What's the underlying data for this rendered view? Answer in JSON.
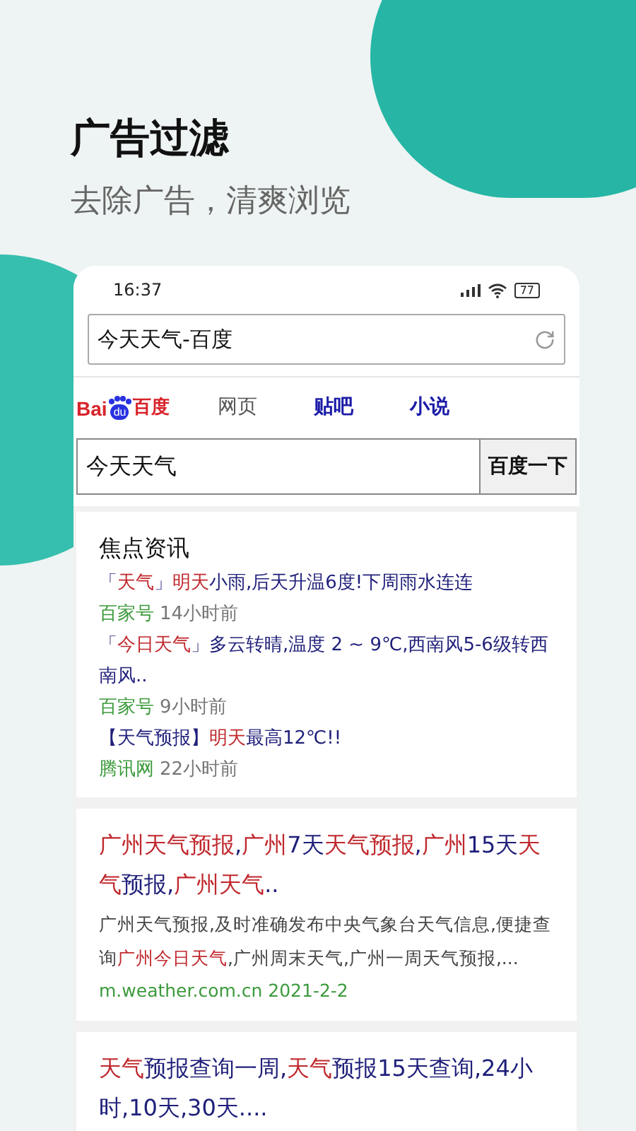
{
  "header": {
    "title": "广告过滤",
    "subtitle": "去除广告，清爽浏览"
  },
  "status_bar": {
    "time": "16:37",
    "battery": "77"
  },
  "address_bar": {
    "value": "今天天气-百度"
  },
  "nav": {
    "logo": {
      "left": "Bai",
      "paw": "du",
      "right": "百度"
    },
    "tabs": [
      {
        "label": "网页",
        "selected": false
      },
      {
        "label": "贴吧",
        "selected": true
      },
      {
        "label": "小说",
        "selected": true
      }
    ]
  },
  "search": {
    "value": "今天天气",
    "button": "百度一下"
  },
  "news": {
    "title": "焦点资讯",
    "items": [
      {
        "headline": [
          {
            "t": "「",
            "hl": false
          },
          {
            "t": "天气",
            "hl": true
          },
          {
            "t": "」",
            "hl": false
          },
          {
            "t": "明天",
            "hl": true
          },
          {
            "t": "小雨,后天升温6度!下周雨水连连",
            "hl": false
          }
        ],
        "source": "百家号",
        "time": "14小时前"
      },
      {
        "headline": [
          {
            "t": "「",
            "hl": false
          },
          {
            "t": "今日天气",
            "hl": true
          },
          {
            "t": "」多云转晴,温度 2 ~ 9℃,西南风5-6级转西南风..",
            "hl": false
          }
        ],
        "source": "百家号",
        "time": "9小时前"
      },
      {
        "headline": [
          {
            "t": "【天气预报】",
            "hl": false
          },
          {
            "t": "明天",
            "hl": true
          },
          {
            "t": "最高12℃!!",
            "hl": false
          }
        ],
        "source": "腾讯网",
        "time": "22小时前"
      }
    ]
  },
  "results": [
    {
      "title": [
        {
          "t": "广州天气预报",
          "hl": true
        },
        {
          "t": ",",
          "hl": false
        },
        {
          "t": "广州",
          "hl": true
        },
        {
          "t": "7天",
          "hl": false
        },
        {
          "t": "天气预报",
          "hl": true
        },
        {
          "t": ",",
          "hl": false
        },
        {
          "t": "广州",
          "hl": true
        },
        {
          "t": "15天",
          "hl": false
        },
        {
          "t": "天气",
          "hl": true
        },
        {
          "t": "预报,",
          "hl": false
        },
        {
          "t": "广州天气",
          "hl": true
        },
        {
          "t": "..",
          "hl": false
        }
      ],
      "description": [
        {
          "t": "广州天气预报,及时准确发布中央气象台天气信息,便捷查询",
          "hl": false
        },
        {
          "t": "广州今日天气",
          "hl": true
        },
        {
          "t": ",广州周末天气,广州一周天气预报,...",
          "hl": false
        }
      ],
      "url": "m.weather.com.cn 2021-2-2"
    },
    {
      "title": [
        {
          "t": "天气",
          "hl": true
        },
        {
          "t": "预报查询一周,",
          "hl": false
        },
        {
          "t": "天气",
          "hl": true
        },
        {
          "t": "预报15天查询,24小时,10天,30天....",
          "hl": false
        }
      ]
    }
  ]
}
